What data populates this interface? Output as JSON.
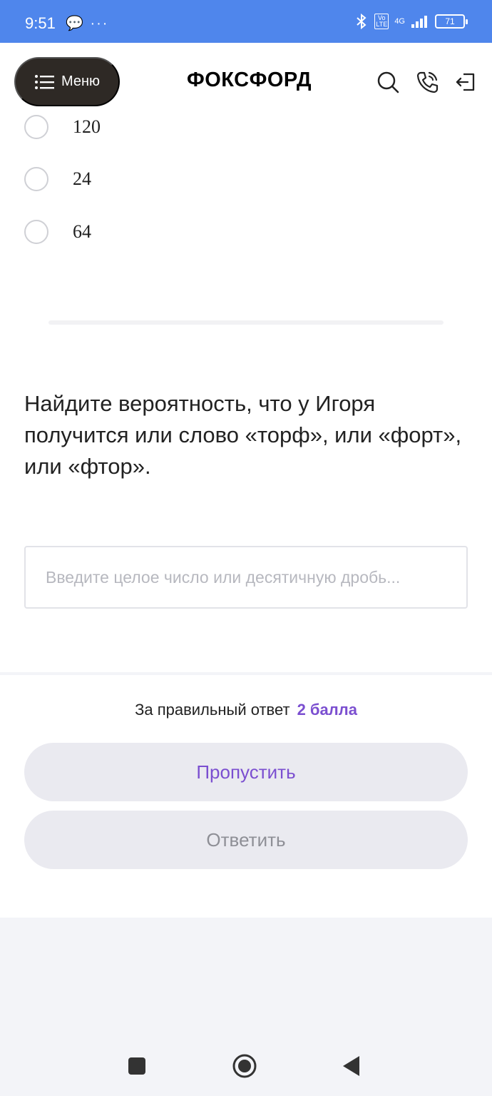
{
  "status_bar": {
    "time": "9:51",
    "left_icons": "💬 ···",
    "network": "4G",
    "volte": "Vo LTE",
    "battery": "71"
  },
  "header": {
    "menu_label": "Меню",
    "logo": "ФОКСФОРД"
  },
  "options": [
    {
      "label": "120"
    },
    {
      "label": "24"
    },
    {
      "label": "64"
    }
  ],
  "question": "Найдите вероятность, что у Игоря получится или слово «торф», или «форт», или «фтор».",
  "answer": {
    "placeholder": "Введите целое число или десятичную дробь...",
    "value": ""
  },
  "footer": {
    "points_text": "За правильный ответ",
    "points_value": "2 балла",
    "skip_label": "Пропустить",
    "answer_label": "Ответить"
  },
  "colors": {
    "status_bar": "#4f86ec",
    "accent": "#7b4fd0",
    "menu_button": "#2e2925"
  },
  "icons": [
    "bluetooth-icon",
    "search-icon",
    "phone-icon",
    "logout-icon",
    "menu-icon",
    "nav-square-icon",
    "nav-home-icon",
    "nav-back-icon"
  ]
}
